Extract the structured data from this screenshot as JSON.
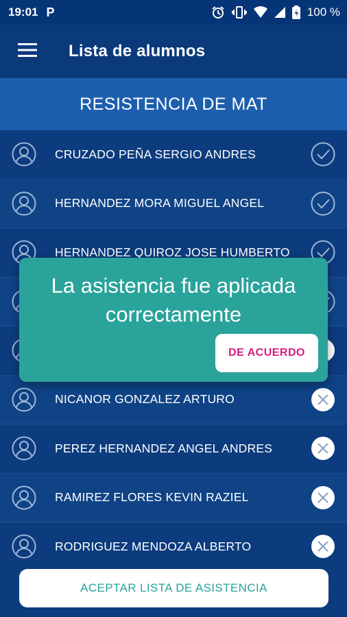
{
  "status_bar": {
    "time": "19:01",
    "notification_icon": "p-icon",
    "battery": "100 %",
    "icons": [
      "alarm-icon",
      "vibrate-icon",
      "wifi-icon",
      "signal-icon",
      "battery-icon"
    ]
  },
  "app_bar": {
    "title": "Lista de alumnos",
    "menu_icon": "menu-icon"
  },
  "subject": "RESISTENCIA DE MAT",
  "students": [
    {
      "name": "CRUZADO PEÑA SERGIO ANDRES",
      "status": "present"
    },
    {
      "name": "HERNANDEZ MORA MIGUEL ANGEL",
      "status": "present"
    },
    {
      "name": "HERNANDEZ QUIROZ JOSE HUMBERTO",
      "status": "present"
    },
    {
      "name": "",
      "status": "present"
    },
    {
      "name": "",
      "status": "absent"
    },
    {
      "name": "NICANOR GONZALEZ ARTURO",
      "status": "absent"
    },
    {
      "name": "PEREZ HERNANDEZ ANGEL ANDRES",
      "status": "absent"
    },
    {
      "name": "RAMIREZ FLORES KEVIN RAZIEL",
      "status": "absent"
    },
    {
      "name": "RODRIGUEZ MENDOZA ALBERTO",
      "status": "absent"
    }
  ],
  "toast": {
    "message": "La asistencia fue aplicada correctamente",
    "button_label": "DE ACUERDO"
  },
  "accept_button_label": "ACEPTAR LISTA DE ASISTENCIA",
  "colors": {
    "app_bar": "#0b3a7b",
    "banner": "#1d5fae",
    "toast": "#2aa39b",
    "toast_button_text": "#d81b80",
    "accept_text": "#27a39b"
  }
}
